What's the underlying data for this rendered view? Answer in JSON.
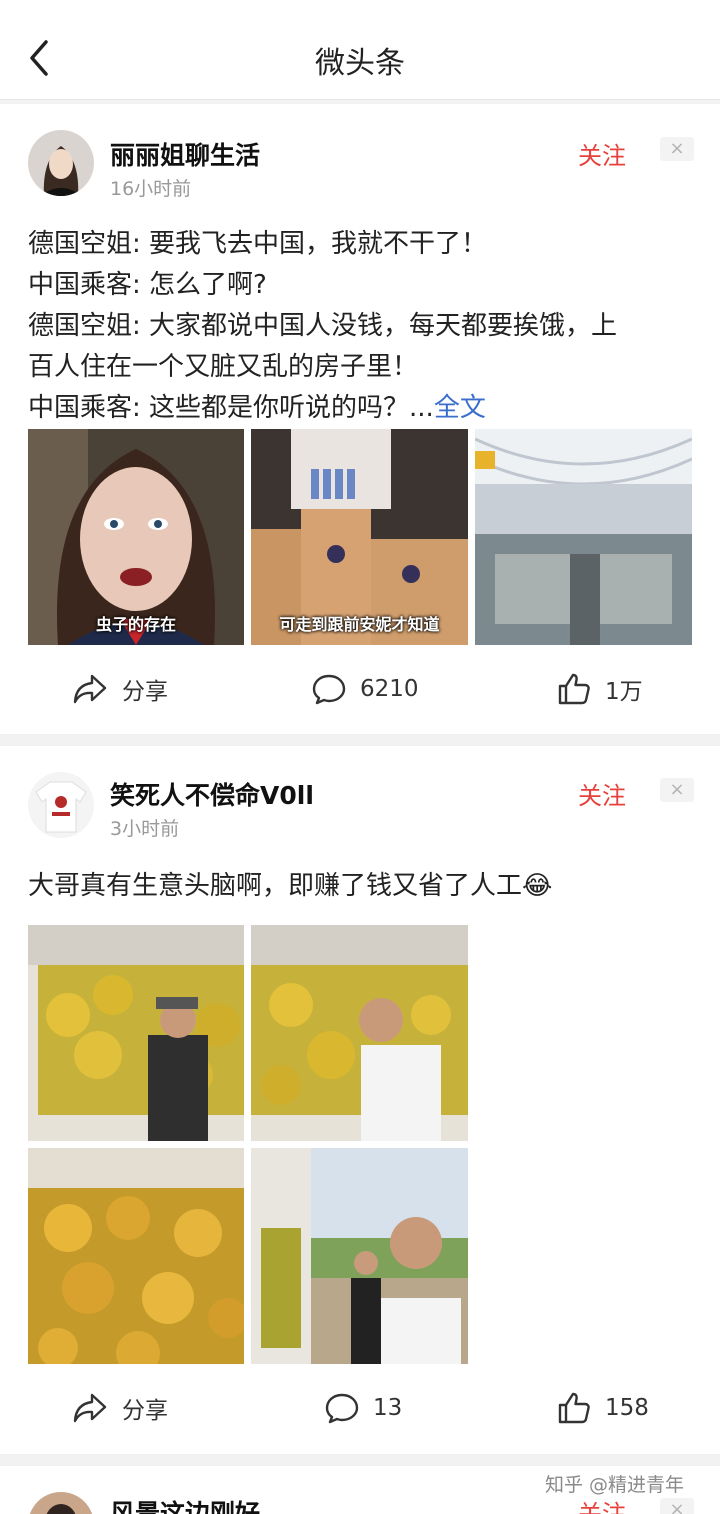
{
  "header": {
    "title": "微头条",
    "back_icon": "chevron-left-icon"
  },
  "posts": [
    {
      "author": "丽丽姐聊生活",
      "time": "16小时前",
      "follow_label": "关注",
      "dismiss": "×",
      "text_lines": [
        "德国空姐: 要我飞去中国，我就不干了！",
        "中国乘客: 怎么了啊?",
        "德国空姐: 大家都说中国人没钱，每天都要挨饿，上",
        "百人住在一个又脏又乱的房子里！",
        "中国乘客: 这些都是你听说的吗？..."
      ],
      "more_label": "全文",
      "image_captions": [
        "虫子的存在",
        "可走到跟前安妮才知道",
        ""
      ],
      "actions": {
        "share_label": "分享",
        "comments": "6210",
        "likes": "1万"
      }
    },
    {
      "author": "笑死人不偿命V0ll",
      "time": "3小时前",
      "follow_label": "关注",
      "dismiss": "×",
      "text": "大哥真有生意头脑啊，即赚了钱又省了人工",
      "emoji": "😂",
      "actions": {
        "share_label": "分享",
        "comments": "13",
        "likes": "158"
      }
    },
    {
      "author": "风景这边刚好",
      "follow_label": "关注",
      "dismiss": "×"
    }
  ],
  "watermark": "知乎 @精进青年"
}
